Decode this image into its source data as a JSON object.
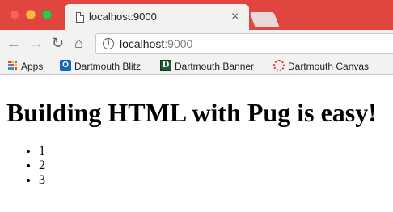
{
  "tab": {
    "title": "localhost:9000",
    "close_symbol": "×",
    "favicon": "document-icon"
  },
  "toolbar": {
    "back_symbol": "←",
    "forward_symbol": "→",
    "reload_symbol": "↻",
    "home_symbol": "⌂",
    "url_host": "localhost",
    "url_port": ":9000",
    "info_symbol": "i"
  },
  "bookmarks": [
    {
      "label": "Apps",
      "icon": "apps-grid-icon"
    },
    {
      "label": "Dartmouth Blitz",
      "icon": "outlook-icon"
    },
    {
      "label": "Dartmouth Banner",
      "icon": "banner-d-icon"
    },
    {
      "label": "Dartmouth Canvas",
      "icon": "canvas-icon"
    }
  ],
  "page": {
    "heading": "Building HTML with Pug is easy!",
    "list_items": [
      "1",
      "2",
      "3"
    ]
  },
  "colors": {
    "tabstrip": "#e1453f",
    "toolbar": "#f2f2f2",
    "apps_grid": [
      "#ea4335",
      "#fbbc05",
      "#34a853",
      "#4285f4",
      "#ea4335",
      "#fbbc05",
      "#34a853",
      "#4285f4",
      "#ea4335"
    ]
  }
}
